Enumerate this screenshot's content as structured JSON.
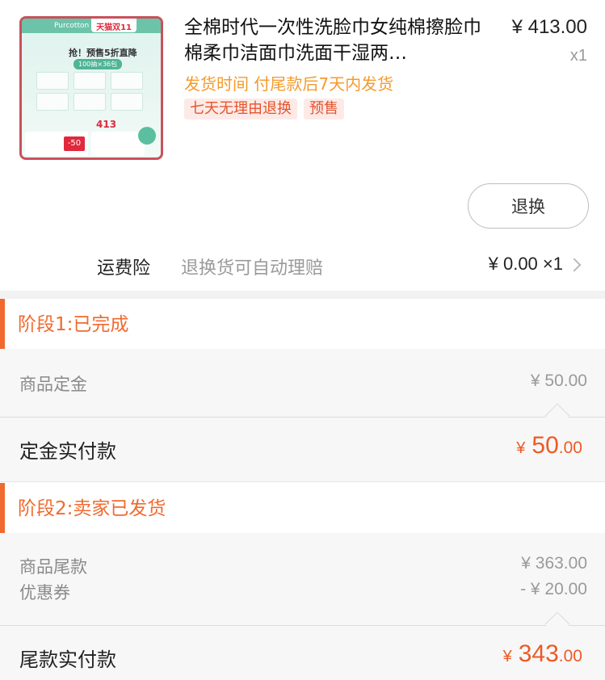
{
  "product": {
    "title": "全棉时代一次性洗脸巾女纯棉擦脸巾棉柔巾洁面巾洗面干湿两…",
    "unit_price": "¥ 413.00",
    "quantity": "x1",
    "ship_time": "发货时间  付尾款后7天内发货",
    "tags": [
      "七天无理由退换",
      "预售"
    ],
    "image": {
      "brand": "Purcotton 全棉时代",
      "platform": "天猫双11",
      "headline": "抢！预售5折直降",
      "pill": "100抽×36包",
      "price": "413",
      "coupon": "-50"
    }
  },
  "exchange_button": "退换",
  "insurance": {
    "label": "运费险",
    "description": "退换货可自动理赔",
    "price": "¥ 0.00 ×1"
  },
  "stage1": {
    "title": "阶段1:已完成",
    "items": [
      {
        "label": "商品定金",
        "value": "¥ 50.00"
      }
    ],
    "paid_label": "定金实付款",
    "paid_currency": "¥",
    "paid_integer": "50",
    "paid_decimal": ".00"
  },
  "stage2": {
    "title": "阶段2:卖家已发货",
    "items": [
      {
        "label": "商品尾款",
        "value": "¥ 363.00"
      },
      {
        "label": "优惠券",
        "value": "- ¥ 20.00"
      }
    ],
    "paid_label": "尾款实付款",
    "paid_currency": "¥",
    "paid_integer": "343",
    "paid_decimal": ".00"
  },
  "colors": {
    "accent": "#ee5a24",
    "stage_title": "#f06a2f",
    "ship_time": "#f49b2c",
    "tag_bg": "#fdeae6"
  }
}
